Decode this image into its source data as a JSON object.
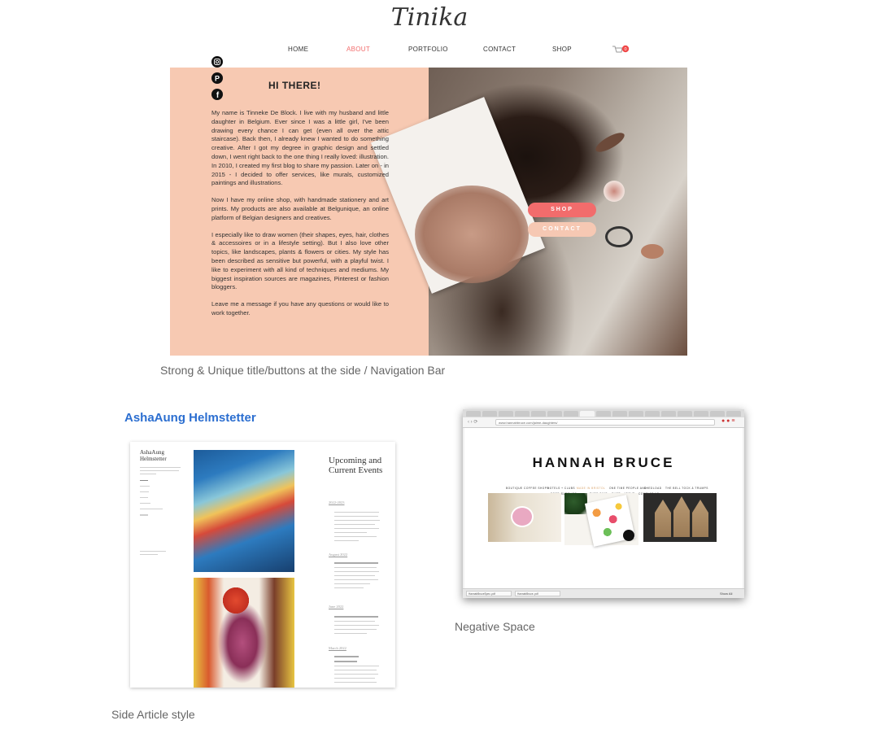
{
  "tinika": {
    "logo": "Tinika",
    "nav": [
      "HOME",
      "ABOUT",
      "PORTFOLIO",
      "CONTACT",
      "SHOP"
    ],
    "active_nav": "ABOUT",
    "cart_count": "0",
    "heading": "HI THERE!",
    "bio": [
      "My name is Tinneke De Block. I live with my husband and little daughter in Belgium. Ever since I was a little girl, I've been drawing every chance I can get (even all over the attic staircase). Back then, I already knew I wanted to do something creative. After I got my degree in graphic design and settled down, I went right back to the one thing I really loved: illustration. In 2010, I created my first blog to share my passion. Later on - in 2015 - I decided to offer services, like murals, customized paintings and illustrations.",
      "Now I have my online shop, with handmade stationery and art prints. My products are also available at Belgunique, an online platform of Belgian designers and creatives.",
      "I especially like to draw women (their shapes, eyes, hair, clothes & accessoires or in a lifestyle setting). But I also love other topics, like landscapes, plants & flowers or cities. My style has been described as sensitive but powerful, with a playful twist. I like to experiment with all kind of techniques and mediums. My biggest inspiration sources are magazines, Pinterest or fashion bloggers.",
      "Leave me a message if you have any questions or would like to work together."
    ],
    "btn_shop": "SHOP",
    "btn_contact": "CONTACT",
    "accent": "#f26c6c",
    "panel_color": "#f7c9b2"
  },
  "captions": {
    "tinika": "Strong & Unique title/buttons at the side / Navigation Bar",
    "hannah": "Negative Space",
    "asha": "Side Article style"
  },
  "asha": {
    "title": "AshaAung Helmstetter",
    "site_name": "AshaAung Helmstetter",
    "events_title": "Upcoming and Current Events",
    "event_heads": [
      "2022-2023",
      "August 2022",
      "June 2022",
      "March 2022"
    ],
    "link_color": "#2b6ed0"
  },
  "hannah": {
    "url": "www.hannahbruce.com/jaime-daughters/",
    "title": "HANNAH BRUCE",
    "nav_row1": [
      "BOUTIQUE COFFEE SHOPS",
      "HOTELS + CLUBS",
      "MADE IN BRISTOL",
      "ONE TIME PEOPLE AND",
      "SHEDLOAD",
      "THE BELL TOCK & TRUMPS"
    ],
    "nav_row2": [
      "FOOD SUPPLIES",
      "PURE SIMS",
      "SHOP",
      "ABOUT",
      "CONTACT US"
    ],
    "downloads": [
      "HannahBruceSpec..pdf",
      "HannahBruce..pdf"
    ],
    "show_all": "Show All"
  }
}
